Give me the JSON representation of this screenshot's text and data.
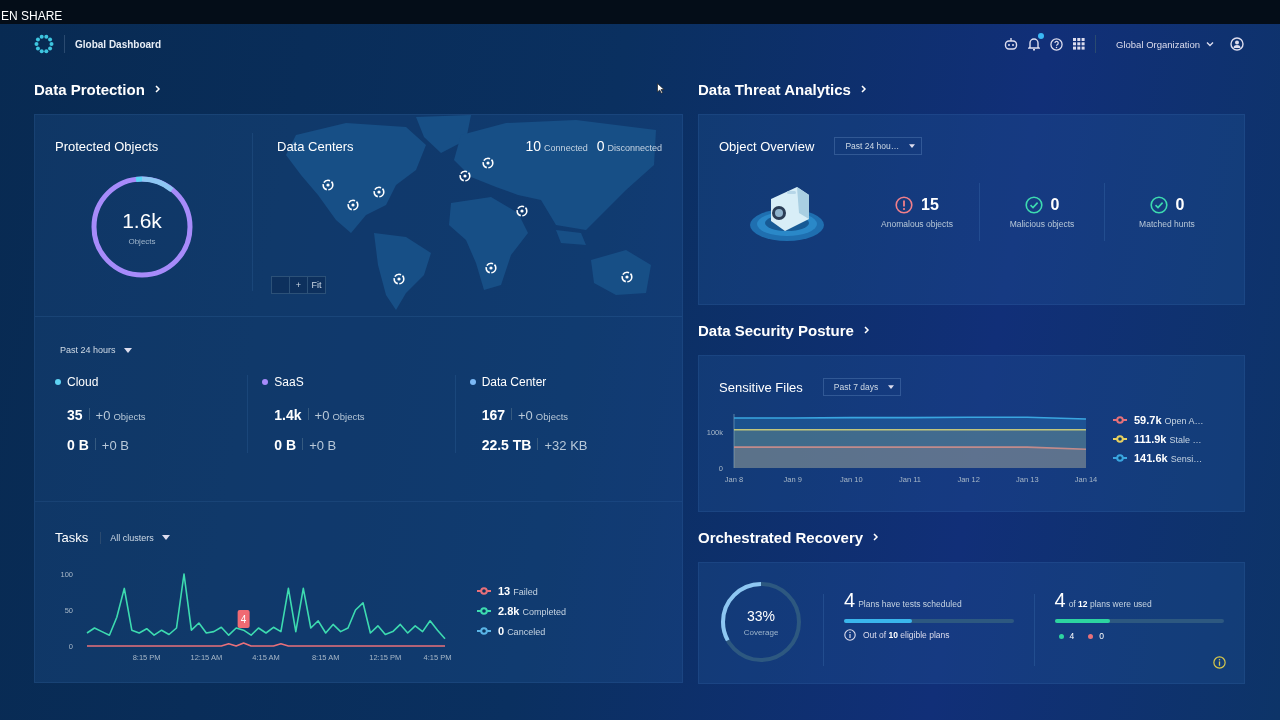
{
  "top_strip": {
    "text": "EN SHARE"
  },
  "header": {
    "title": "Global Dashboard",
    "notifications_unread": true,
    "organization": "Global Organization"
  },
  "data_protection": {
    "title": "Data Protection",
    "protected_objects": {
      "title": "Protected Objects",
      "value": "1.6k",
      "unit": "Objects"
    },
    "data_centers": {
      "title": "Data Centers",
      "connected": "10",
      "connected_label": "Connected",
      "disconnected": "0",
      "disconnected_label": "Disconnected",
      "map_controls": [
        "+",
        "Fit"
      ]
    },
    "period": "Past 24 hours",
    "sources": [
      {
        "name": "Cloud",
        "color": "#5fd3f3",
        "objects": "35",
        "objects_delta": "+0",
        "objects_unit": "Objects",
        "size": "0 B",
        "size_delta": "+0 B"
      },
      {
        "name": "SaaS",
        "color": "#a78bfa",
        "objects": "1.4k",
        "objects_delta": "+0",
        "objects_unit": "Objects",
        "size": "0 B",
        "size_delta": "+0 B"
      },
      {
        "name": "Data Center",
        "color": "#7cb8f5",
        "objects": "167",
        "objects_delta": "+0",
        "objects_unit": "Objects",
        "size": "22.5 TB",
        "size_delta": "+32 KB"
      }
    ],
    "tasks": {
      "title": "Tasks",
      "filter": "All clusters",
      "chart_data": {
        "type": "line",
        "categories": [
          null,
          null,
          null,
          null,
          null,
          null,
          null,
          null,
          "8:15 PM",
          null,
          null,
          null,
          null,
          null,
          null,
          null,
          "12:15 AM",
          null,
          null,
          null,
          null,
          null,
          null,
          null,
          "4:15 AM",
          null,
          null,
          null,
          null,
          null,
          null,
          null,
          "8:15 AM",
          null,
          null,
          null,
          null,
          null,
          null,
          null,
          "12:15 PM",
          null,
          null,
          null,
          null,
          null,
          null,
          "4:15 PM",
          null
        ],
        "ylim": [
          0,
          100
        ],
        "yticks": [
          0,
          50,
          100
        ],
        "series": [
          {
            "name": "Failed",
            "color": "#e8707a",
            "values": [
              0,
              0,
              0,
              0,
              0,
              0,
              0,
              0,
              0,
              0,
              0,
              0,
              0,
              0,
              0,
              0,
              0,
              0,
              0,
              3,
              0,
              4,
              0,
              0,
              0,
              0,
              3,
              0,
              0,
              0,
              0,
              0,
              0,
              0,
              0,
              0,
              0,
              0,
              0,
              0,
              0,
              0,
              0,
              0,
              0,
              0,
              0,
              0,
              0
            ]
          },
          {
            "name": "Completed",
            "color": "#3ddbb0",
            "values": [
              18,
              25,
              20,
              15,
              40,
              80,
              22,
              18,
              24,
              15,
              22,
              16,
              25,
              100,
              22,
              32,
              18,
              20,
              26,
              15,
              25,
              22,
              15,
              25,
              18,
              26,
              20,
              80,
              20,
              80,
              25,
              35,
              18,
              30,
              20,
              25,
              50,
              60,
              18,
              28,
              16,
              20,
              30,
              18,
              28,
              20,
              35,
              22,
              10
            ]
          },
          {
            "name": "Canceled",
            "color": "#5ab4e6",
            "values": [
              null,
              null,
              null,
              null,
              null,
              null,
              null,
              null,
              null,
              null,
              null,
              null,
              null,
              null,
              null,
              null,
              null,
              null,
              null,
              null,
              null,
              null,
              null,
              null,
              null,
              null,
              null,
              null,
              null,
              null,
              null,
              null,
              null,
              null,
              null,
              null,
              null,
              null,
              null,
              null,
              null,
              null,
              null,
              null,
              null,
              null,
              null,
              null,
              null
            ]
          }
        ]
      },
      "tooltip": {
        "text": "4"
      },
      "legend": [
        {
          "value": "13"
        },
        {
          "value": "2.8k"
        },
        {
          "value": "0"
        }
      ]
    }
  },
  "data_threat_analytics": {
    "title": "Data Threat Analytics",
    "object_overview": {
      "title": "Object Overview",
      "period": "Past 24 hou…",
      "stats": [
        {
          "kind": "alert",
          "value": "15",
          "label": "Anomalous objects"
        },
        {
          "kind": "ok",
          "value": "0",
          "label": "Malicious objects"
        },
        {
          "kind": "ok",
          "value": "0",
          "label": "Matched hunts"
        }
      ]
    }
  },
  "data_security_posture": {
    "title": "Data Security Posture",
    "sensitive_files": {
      "title": "Sensitive Files",
      "period": "Past 7 days",
      "chart_data": {
        "type": "area",
        "categories": [
          "Jan 8",
          "Jan 9",
          "Jan 10",
          "Jan 11",
          "Jan 12",
          "Jan 13",
          "Jan 14"
        ],
        "ylim": [
          0,
          150000
        ],
        "yticks": [
          0,
          {
            "value": 100000,
            "label": "100k"
          }
        ],
        "series": [
          {
            "name": "Open A…",
            "color": "#e8707a",
            "values": [
              58000,
              58000,
              58000,
              58000,
              58000,
              58000,
              52000
            ]
          },
          {
            "name": "Stale …",
            "color": "#e8d060",
            "values": [
              106000,
              106000,
              106000,
              106000,
              106000,
              106000,
              106000
            ]
          },
          {
            "name": "Sensi…",
            "color": "#3aa6e0",
            "values": [
              139000,
              139000,
              140000,
              140000,
              141000,
              141000,
              136000
            ]
          }
        ]
      },
      "legend": [
        {
          "value": "59.7k"
        },
        {
          "value": "111.9k"
        },
        {
          "value": "141.6k"
        }
      ]
    }
  },
  "orchestrated_recovery": {
    "title": "Orchestrated Recovery",
    "coverage": {
      "value": "33%",
      "label": "Coverage",
      "level": 0.33
    },
    "scheduled": {
      "count": "4",
      "text": "Plans have tests scheduled",
      "level": 0.4,
      "note": "Out of **10** eligible plans"
    },
    "used": {
      "count": "4",
      "text": "of **12** plans were used",
      "level": 0.33,
      "breakdown": [
        {
          "value": "4",
          "color": "#2dd4a0"
        },
        {
          "value": "0",
          "color": "#e8707a"
        }
      ]
    }
  }
}
